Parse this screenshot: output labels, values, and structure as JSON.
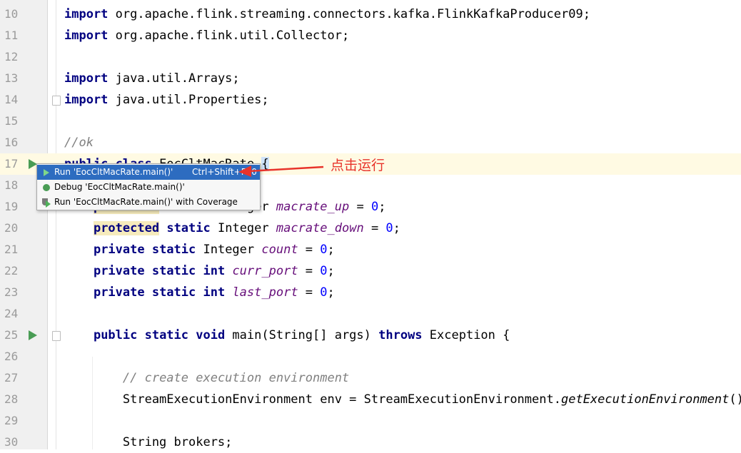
{
  "editor": {
    "lines": [
      {
        "n": "10",
        "parts": [
          [
            "kw",
            "import"
          ],
          [
            "t",
            " org.apache.flink.streaming.connectors.kafka.FlinkKafkaProducer09;"
          ]
        ]
      },
      {
        "n": "11",
        "parts": [
          [
            "kw",
            "import"
          ],
          [
            "t",
            " org.apache.flink.util.Collector;"
          ]
        ]
      },
      {
        "n": "12",
        "parts": []
      },
      {
        "n": "13",
        "parts": [
          [
            "kw",
            "import"
          ],
          [
            "t",
            " java.util.Arrays;"
          ]
        ]
      },
      {
        "n": "14",
        "parts": [
          [
            "kw",
            "import"
          ],
          [
            "t",
            " java.util.Properties;"
          ]
        ]
      },
      {
        "n": "15",
        "parts": []
      },
      {
        "n": "16",
        "parts": [
          [
            "cmt",
            "//ok"
          ]
        ]
      },
      {
        "n": "17",
        "parts": [
          [
            "kw",
            "public class"
          ],
          [
            "t",
            " EocCltMacRate "
          ],
          [
            "caret",
            "{"
          ]
        ]
      },
      {
        "n": "18",
        "parts": []
      },
      {
        "n": "19",
        "parts": [
          [
            "t",
            "    "
          ],
          [
            "kwh",
            "protected"
          ],
          [
            "t",
            " "
          ],
          [
            "kw",
            "static"
          ],
          [
            "t",
            " Integer "
          ],
          [
            "fld",
            "macrate_up"
          ],
          [
            "t",
            " = "
          ],
          [
            "num",
            "0"
          ],
          [
            "t",
            ";"
          ]
        ]
      },
      {
        "n": "20",
        "parts": [
          [
            "t",
            "    "
          ],
          [
            "kwh",
            "protected"
          ],
          [
            "t",
            " "
          ],
          [
            "kw",
            "static"
          ],
          [
            "t",
            " Integer "
          ],
          [
            "fld",
            "macrate_down"
          ],
          [
            "t",
            " = "
          ],
          [
            "num",
            "0"
          ],
          [
            "t",
            ";"
          ]
        ]
      },
      {
        "n": "21",
        "parts": [
          [
            "t",
            "    "
          ],
          [
            "kw",
            "private static"
          ],
          [
            "t",
            " Integer "
          ],
          [
            "fld",
            "count"
          ],
          [
            "t",
            " = "
          ],
          [
            "num",
            "0"
          ],
          [
            "t",
            ";"
          ]
        ]
      },
      {
        "n": "22",
        "parts": [
          [
            "t",
            "    "
          ],
          [
            "kw",
            "private static int"
          ],
          [
            "t",
            " "
          ],
          [
            "fld",
            "curr_port"
          ],
          [
            "t",
            " = "
          ],
          [
            "num",
            "0"
          ],
          [
            "t",
            ";"
          ]
        ]
      },
      {
        "n": "23",
        "parts": [
          [
            "t",
            "    "
          ],
          [
            "kw",
            "private static int"
          ],
          [
            "t",
            " "
          ],
          [
            "fld",
            "last_port"
          ],
          [
            "t",
            " = "
          ],
          [
            "num",
            "0"
          ],
          [
            "t",
            ";"
          ]
        ]
      },
      {
        "n": "24",
        "parts": []
      },
      {
        "n": "25",
        "parts": [
          [
            "t",
            "    "
          ],
          [
            "kw",
            "public static void"
          ],
          [
            "t",
            " main(String[] args) "
          ],
          [
            "kw",
            "throws"
          ],
          [
            "t",
            " Exception {"
          ]
        ]
      },
      {
        "n": "26",
        "parts": []
      },
      {
        "n": "27",
        "parts": [
          [
            "t",
            "        "
          ],
          [
            "cmt",
            "// create execution environment"
          ]
        ]
      },
      {
        "n": "28",
        "parts": [
          [
            "t",
            "        StreamExecutionEnvironment env = StreamExecutionEnvironment."
          ],
          [
            "mth",
            "getExecutionEnvironment"
          ],
          [
            "t",
            "();"
          ]
        ]
      },
      {
        "n": "29",
        "parts": []
      },
      {
        "n": "30",
        "parts": [
          [
            "t",
            "        String brokers;"
          ]
        ]
      }
    ]
  },
  "popup": {
    "items": [
      {
        "label": "Run 'EocCltMacRate.main()'",
        "shortcut": "Ctrl+Shift+F10",
        "icon": "run-icon"
      },
      {
        "label": "Debug 'EocCltMacRate.main()'",
        "shortcut": "",
        "icon": "debug-icon"
      },
      {
        "label": "Run 'EocCltMacRate.main()' with Coverage",
        "shortcut": "",
        "icon": "coverage-icon"
      }
    ]
  },
  "annotation": {
    "text": "点击运行",
    "color": "#e8332a"
  },
  "colors": {
    "keyword": "#000080",
    "field": "#660e7a",
    "number": "#0000ff",
    "comment": "#808080",
    "selection": "#2d6cc0",
    "run_green": "#499c54"
  }
}
